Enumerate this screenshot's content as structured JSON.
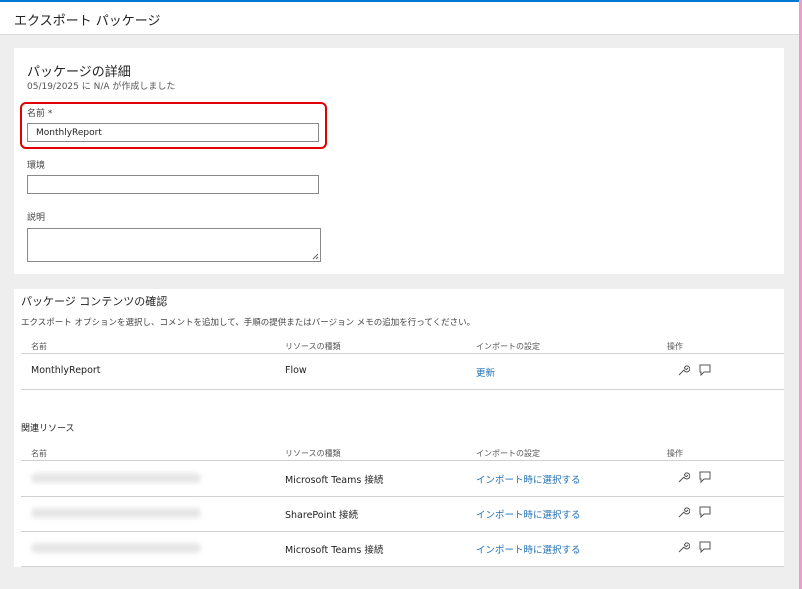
{
  "header": {
    "title": "エクスポート パッケージ"
  },
  "details": {
    "title": "パッケージの詳細",
    "subtitle": "05/19/2025 に N/A が作成しました",
    "name_label": "名前 *",
    "name_value": "MonthlyReport",
    "env_label": "環境",
    "env_value": "",
    "desc_label": "説明",
    "desc_value": ""
  },
  "contents": {
    "title": "パッケージ コンテンツの確認",
    "description": "エクスポート オプションを選択し、コメントを追加して、手順の提供またはバージョン メモの追加を行ってください。",
    "columns": {
      "name": "名前",
      "type": "リソースの種類",
      "import": "インポートの設定",
      "actions": "操作"
    },
    "rows": [
      {
        "name": "MonthlyReport",
        "type": "Flow",
        "import": "更新"
      }
    ]
  },
  "related": {
    "title": "関連リソース",
    "columns": {
      "name": "名前",
      "type": "リソースの種類",
      "import": "インポートの設定",
      "actions": "操作"
    },
    "rows": [
      {
        "type": "Microsoft Teams 接続",
        "import": "インポート時に選択する"
      },
      {
        "type": "SharePoint 接続",
        "import": "インポート時に選択する"
      },
      {
        "type": "Microsoft Teams 接続",
        "import": "インポート時に選択する"
      }
    ]
  },
  "icons": {
    "edit": "wrench-icon",
    "comment": "comment-icon"
  },
  "colors": {
    "accent": "#0078d4",
    "link": "#1f6fb5",
    "highlight": "#e00000"
  }
}
